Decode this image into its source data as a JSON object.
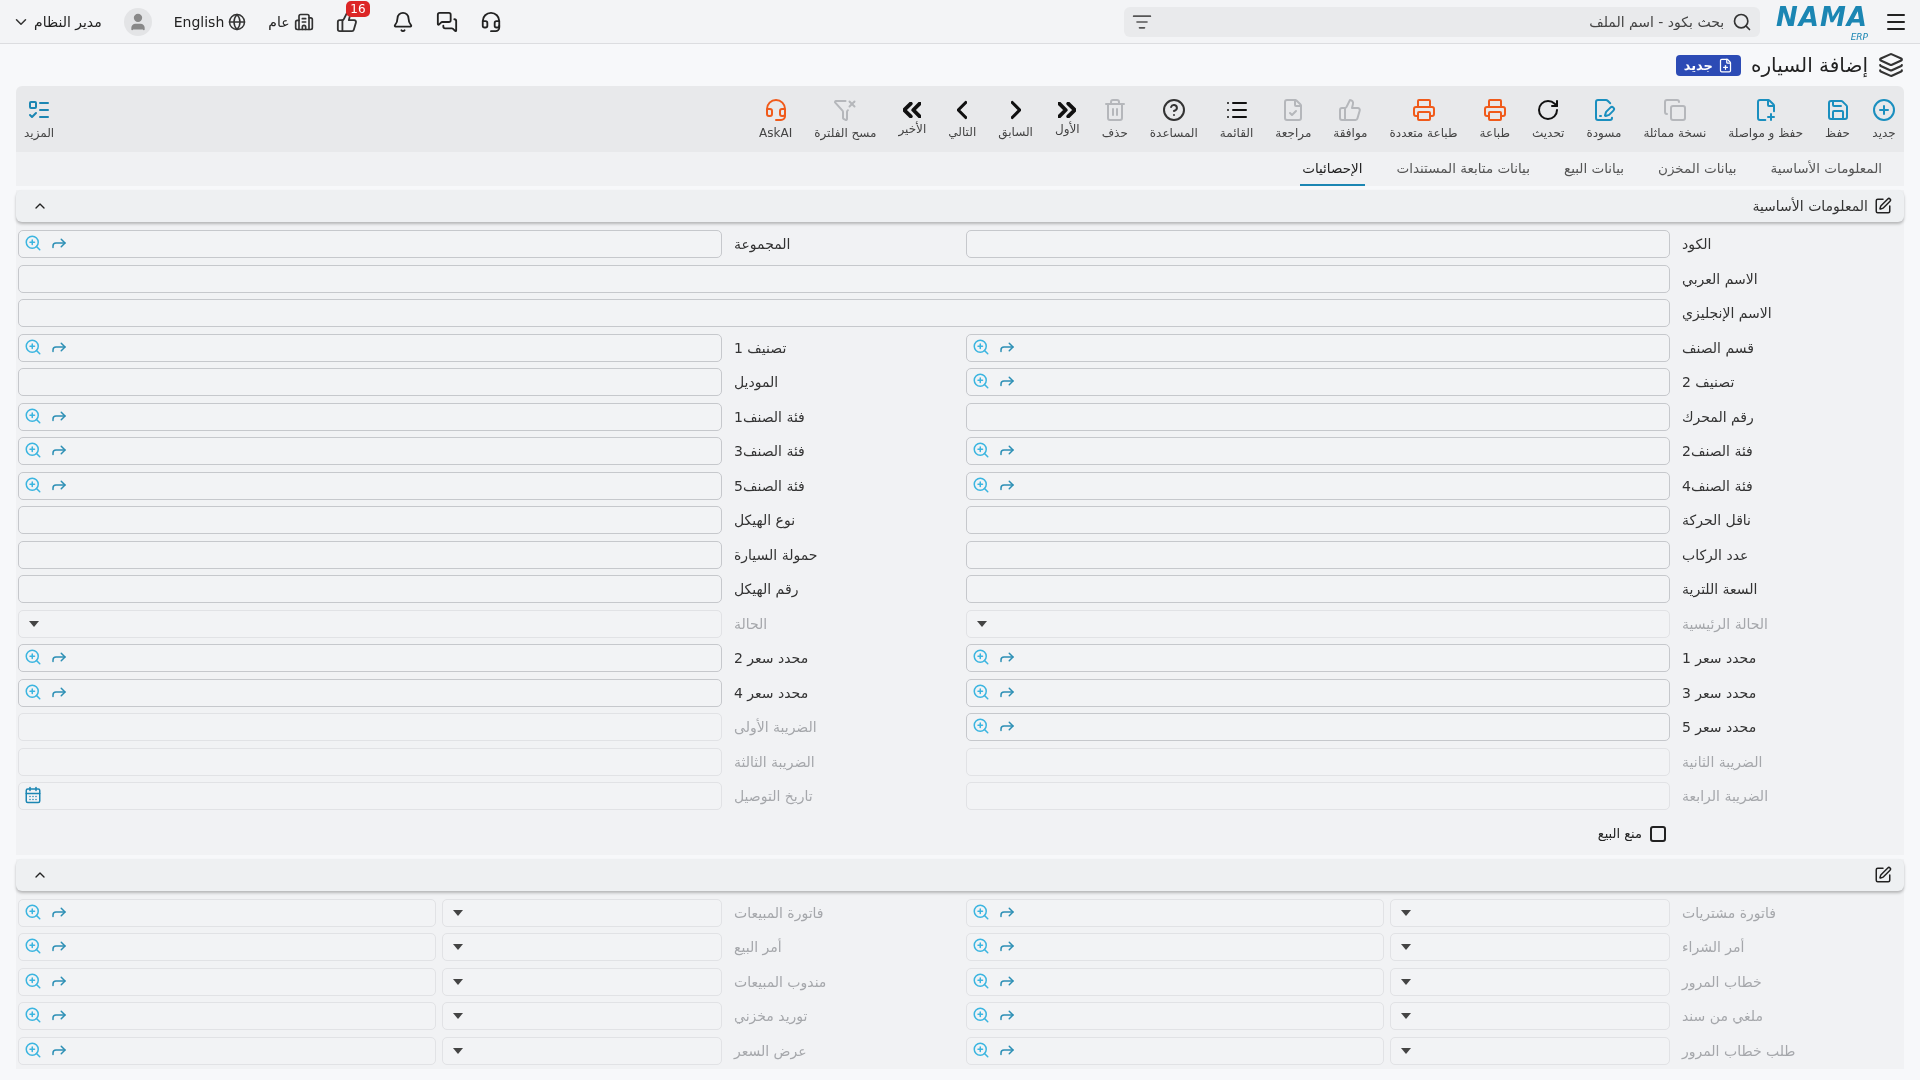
{
  "topbar": {
    "logo": {
      "name": "NAMA",
      "sub": "ERP"
    },
    "search": {
      "placeholder": "بحث بكود - اسم الملف"
    },
    "notifications_badge": "16",
    "company": "عام",
    "language": "English",
    "user": "مدير النظام"
  },
  "page": {
    "title": "إضافة السياره",
    "status": "جديد"
  },
  "toolbar": {
    "buttons": [
      {
        "label": "جديد",
        "disabled": false,
        "color": "#1a8fbf"
      },
      {
        "label": "حفظ",
        "disabled": false,
        "color": "#1a8fbf"
      },
      {
        "label": "حفظ و مواصلة",
        "disabled": false,
        "color": "#1a8fbf"
      },
      {
        "label": "نسخة مماثلة",
        "disabled": true
      },
      {
        "label": "مسودة",
        "disabled": false,
        "color": "#1a8fbf"
      },
      {
        "label": "تحديث",
        "disabled": false,
        "color": "#111111"
      },
      {
        "label": "طباعة",
        "disabled": false,
        "color": "#f05a1a"
      },
      {
        "label": "طباعة متعددة",
        "disabled": false,
        "color": "#f05a1a"
      },
      {
        "label": "موافقة",
        "disabled": true
      },
      {
        "label": "مراجعة",
        "disabled": true
      },
      {
        "label": "القائمة",
        "disabled": false,
        "color": "#111111"
      },
      {
        "label": "المساعدة",
        "disabled": false,
        "color": "#333333"
      },
      {
        "label": "حذف",
        "disabled": true
      },
      {
        "label": "الأول",
        "disabled": false,
        "color": "#111111"
      },
      {
        "label": "السابق",
        "disabled": false,
        "color": "#111111"
      },
      {
        "label": "التالي",
        "disabled": false,
        "color": "#111111"
      },
      {
        "label": "الأخير",
        "disabled": false,
        "color": "#111111"
      },
      {
        "label": "مسح الفلترة",
        "disabled": true
      },
      {
        "label": "AskAI",
        "disabled": false,
        "color": "#f05a1a"
      }
    ],
    "more": "المزيد"
  },
  "tabs": [
    {
      "label": "المعلومات الأساسية",
      "selected": false
    },
    {
      "label": "بيانات المخزن",
      "selected": false
    },
    {
      "label": "بيانات البيع",
      "selected": false
    },
    {
      "label": "بيانات متابعة المستندات",
      "selected": false
    },
    {
      "label": "الإحصائيات",
      "selected": true
    }
  ],
  "sections": [
    {
      "title": "المعلومات الأساسية",
      "expanded": true,
      "rows": [
        [
          {
            "label": "الكود",
            "kind": "text",
            "disabled": false
          },
          {
            "label": "المجموعة",
            "kind": "lookup",
            "disabled": false
          }
        ],
        [
          {
            "label": "الاسم العربي",
            "kind": "text",
            "disabled": false
          }
        ],
        [
          {
            "label": "الاسم الإنجليزي",
            "kind": "text",
            "disabled": false
          }
        ],
        [
          {
            "label": "قسم الصنف",
            "kind": "lookup",
            "disabled": false
          },
          {
            "label": "تصنيف 1",
            "kind": "lookup",
            "disabled": false
          }
        ],
        [
          {
            "label": "تصنيف 2",
            "kind": "lookup",
            "disabled": false
          },
          {
            "label": "الموديل",
            "kind": "text",
            "disabled": false
          }
        ],
        [
          {
            "label": "رقم المحرك",
            "kind": "text",
            "disabled": false
          },
          {
            "label": "فئة الصنف1",
            "kind": "lookup",
            "disabled": false
          }
        ],
        [
          {
            "label": "فئة الصنف2",
            "kind": "lookup",
            "disabled": false
          },
          {
            "label": "فئة الصنف3",
            "kind": "lookup",
            "disabled": false
          }
        ],
        [
          {
            "label": "فئة الصنف4",
            "kind": "lookup",
            "disabled": false
          },
          {
            "label": "فئة الصنف5",
            "kind": "lookup",
            "disabled": false
          }
        ],
        [
          {
            "label": "ناقل الحركة",
            "kind": "text",
            "disabled": false
          },
          {
            "label": "نوع الهيكل",
            "kind": "text",
            "disabled": false
          }
        ],
        [
          {
            "label": "عدد الركاب",
            "kind": "text",
            "disabled": false
          },
          {
            "label": "حمولة السيارة",
            "kind": "text",
            "disabled": false
          }
        ],
        [
          {
            "label": "السعة اللترية",
            "kind": "text",
            "disabled": false
          },
          {
            "label": "رقم الهيكل",
            "kind": "text",
            "disabled": false
          }
        ],
        [
          {
            "label": "الحالة الرئيسية",
            "kind": "select",
            "disabled": true
          },
          {
            "label": "الحالة",
            "kind": "select",
            "disabled": true
          }
        ],
        [
          {
            "label": "محدد سعر 1",
            "kind": "lookup",
            "disabled": false
          },
          {
            "label": "محدد سعر 2",
            "kind": "lookup",
            "disabled": false
          }
        ],
        [
          {
            "label": "محدد سعر 3",
            "kind": "lookup",
            "disabled": false
          },
          {
            "label": "محدد سعر 4",
            "kind": "lookup",
            "disabled": false
          }
        ],
        [
          {
            "label": "محدد سعر 5",
            "kind": "lookup",
            "disabled": false
          },
          {
            "label": "الضريبة الأولى",
            "kind": "text",
            "disabled": true
          }
        ],
        [
          {
            "label": "الضريبة الثانية",
            "kind": "text",
            "disabled": true
          },
          {
            "label": "الضريبة الثالثة",
            "kind": "text",
            "disabled": true
          }
        ],
        [
          {
            "label": "الضريبة الرابعة",
            "kind": "text",
            "disabled": true
          },
          {
            "label": "تاريخ التوصيل",
            "kind": "date",
            "disabled": true
          }
        ]
      ],
      "checkbox": {
        "label": "منع البيع",
        "checked": false
      }
    },
    {
      "expanded": true,
      "rows": [
        [
          {
            "label": "فاتورة مشتريات",
            "kind": "doc",
            "disabled": true
          },
          {
            "label": "فاتورة المبيعات",
            "kind": "doc",
            "disabled": true
          }
        ],
        [
          {
            "label": "أمر الشراء",
            "kind": "doc",
            "disabled": true
          },
          {
            "label": "أمر البيع",
            "kind": "doc",
            "disabled": true
          }
        ],
        [
          {
            "label": "خطاب المرور",
            "kind": "doc",
            "disabled": true
          },
          {
            "label": "مندوب المبيعات",
            "kind": "doc",
            "disabled": true
          }
        ],
        [
          {
            "label": "ملغي من سند",
            "kind": "doc",
            "disabled": true
          },
          {
            "label": "توريد مخزني",
            "kind": "doc",
            "disabled": true
          }
        ],
        [
          {
            "label": "طلب خطاب المرور",
            "kind": "doc",
            "disabled": true
          },
          {
            "label": "عرض السعر",
            "kind": "doc",
            "disabled": true
          }
        ]
      ]
    }
  ]
}
